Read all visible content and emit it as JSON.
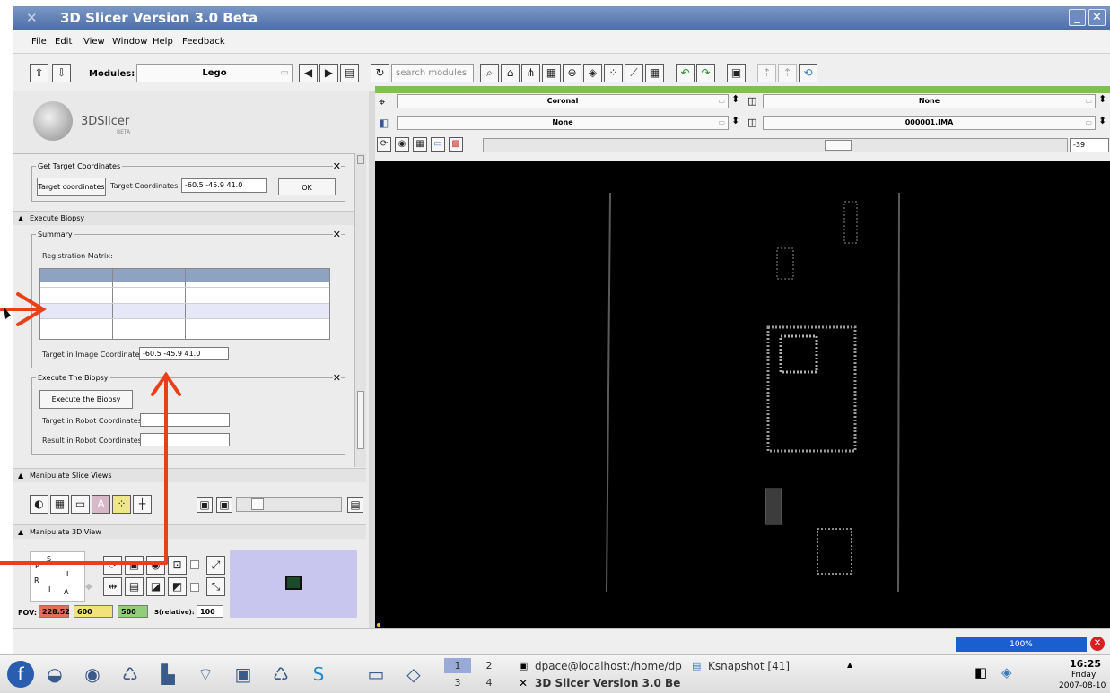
{
  "window": {
    "title": "3D Slicer Version 3.0 Beta",
    "min": "_",
    "close": "✕"
  },
  "menu": [
    "File",
    "Edit",
    "View",
    "Window",
    "Help",
    "Feedback"
  ],
  "toolbar": {
    "modules_label": "Modules:",
    "module_value": "Lego",
    "search_placeholder": "search modules"
  },
  "logo": {
    "name": "3DSlicer",
    "sub": "BETA"
  },
  "get_target": {
    "title": "Get Target Coordinates",
    "button": "Target coordinates",
    "label": "Target Coordinates",
    "value": "-60.5 -45.9 41.0",
    "ok": "OK"
  },
  "execute_biopsy": {
    "header": "Execute Biopsy",
    "summary_title": "Summary",
    "matrix_label": "Registration Matrix:",
    "target_image_label": "Target in Image Coordinates:",
    "target_image_value": "-60.5 -45.9 41.0",
    "execute_title": "Execute The Biopsy",
    "execute_button": "Execute the Biopsy",
    "robot_label": "Target in Robot Coordinates:",
    "result_label": "Result in Robot Coordinates:"
  },
  "slice_views": {
    "header": "Manipulate Slice Views"
  },
  "view3d": {
    "header": "Manipulate 3D View",
    "axis": {
      "s": "S",
      "p": "P",
      "l": "L",
      "r": "R",
      "i": "I",
      "a": "A"
    },
    "fov_label": "FOV:",
    "fov_values": [
      "228.52",
      "600",
      "500"
    ],
    "relative_label": "S(relative):",
    "relative_value": "100"
  },
  "viewer": {
    "orient1": "Coronal",
    "orient2": "None",
    "fg1": "None",
    "fg2": "000001.IMA",
    "slice_value": "-39"
  },
  "status": {
    "progress": "100%"
  },
  "taskbar": {
    "pages": [
      "1",
      "2",
      "3",
      "4"
    ],
    "task1": "dpace@localhost:/home/dp",
    "task2": "Ksnapshot [41]",
    "task3": "3D Slicer Version 3.0 Be",
    "time": "16:25",
    "day": "Friday",
    "date": "2007-08-10"
  },
  "colors": {
    "arrow": "#e8411a",
    "fov_red": "#e0705a",
    "fov_yellow": "#f2e27a",
    "fov_green": "#8fcf7a"
  }
}
